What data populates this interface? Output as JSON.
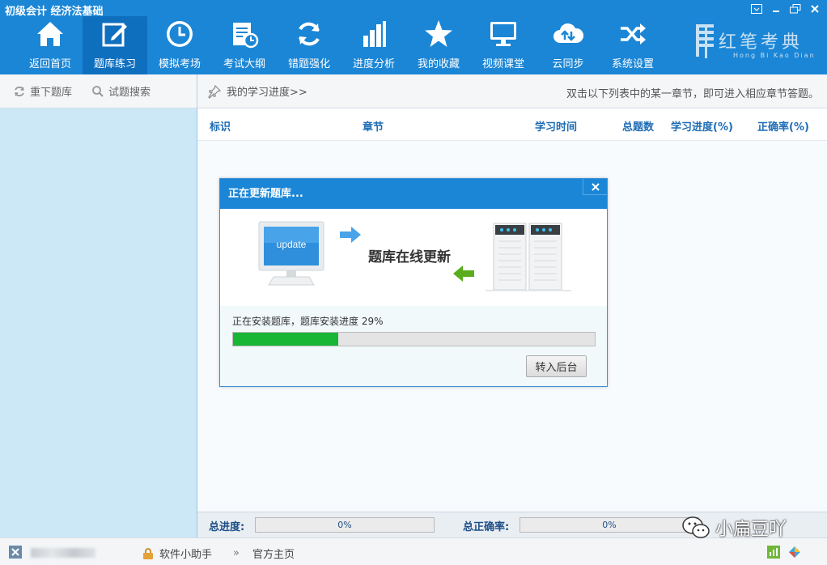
{
  "app": {
    "title": "初级会计 经济法基础"
  },
  "nav": [
    {
      "label": "返回首页",
      "icon": "home-icon"
    },
    {
      "label": "题库练习",
      "icon": "edit-icon"
    },
    {
      "label": "模拟考场",
      "icon": "clock-icon"
    },
    {
      "label": "考试大纲",
      "icon": "syllabus-icon"
    },
    {
      "label": "错题强化",
      "icon": "refresh-icon"
    },
    {
      "label": "进度分析",
      "icon": "bar-chart-icon"
    },
    {
      "label": "我的收藏",
      "icon": "star-icon"
    },
    {
      "label": "视频课堂",
      "icon": "monitor-icon"
    },
    {
      "label": "云同步",
      "icon": "cloud-sync-icon"
    },
    {
      "label": "系统设置",
      "icon": "shuffle-icon"
    }
  ],
  "brand": {
    "main": "红笔考典",
    "sub": "Hong Bi Kao Dian"
  },
  "left_toolbar": {
    "reload": "重下题库",
    "search": "试题搜索"
  },
  "breadcrumb": {
    "text": "我的学习进度>>",
    "hint": "双击以下列表中的某一章节，即可进入相应章节答题。"
  },
  "table": {
    "columns": [
      "标识",
      "章节",
      "学习时间",
      "总题数",
      "学习进度(%)",
      "正确率(%)"
    ]
  },
  "dialog": {
    "title": "正在更新题库...",
    "monitor_text": "update",
    "banner_text": "题库在线更新",
    "status_text": "正在安装题库，题库安装进度 29%",
    "progress": 0.29,
    "background_button": "转入后台"
  },
  "bottom": {
    "total_progress_label": "总进度:",
    "total_progress_value": "0%",
    "total_accuracy_label": "总正确率:",
    "total_accuracy_value": "0%"
  },
  "statusbar": {
    "helper": "软件小助手",
    "home": "官方主页"
  },
  "watermark": "小扁豆吖",
  "colors": {
    "primary": "#1b86d6",
    "progress": "#19b535",
    "left_panel": "#cce8f7"
  }
}
